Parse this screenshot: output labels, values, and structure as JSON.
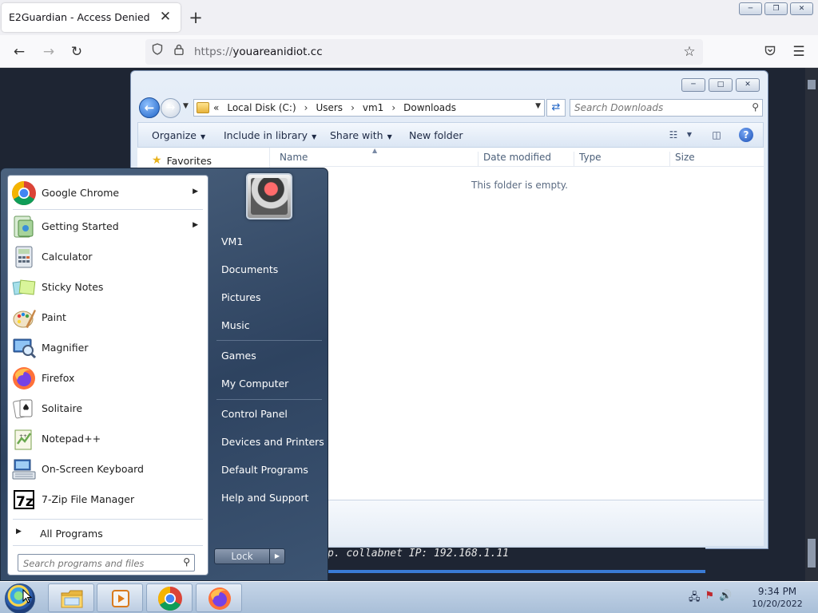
{
  "browser": {
    "tab_title": "E2Guardian - Access Denied",
    "tab_close": "✕",
    "new_tab": "+",
    "url_protocol": "https://",
    "url_host": "youareanidiot.cc"
  },
  "explorer": {
    "crumb_prefix": "«",
    "path": [
      "Local Disk (C:)",
      "Users",
      "vm1",
      "Downloads"
    ],
    "search_placeholder": "Search Downloads",
    "toolbar": {
      "organize": "Organize",
      "include": "Include in library",
      "share": "Share with",
      "new_folder": "New folder"
    },
    "favorites": "Favorites",
    "columns": [
      "Name",
      "Date modified",
      "Type",
      "Size"
    ],
    "empty_message": "This folder is empty."
  },
  "console_text": "p. collabnet   IP: 192.168.1.11",
  "start_menu": {
    "programs": [
      {
        "label": "Google Chrome",
        "submenu": true
      },
      {
        "label": "Getting Started",
        "submenu": true
      },
      {
        "label": "Calculator",
        "submenu": false
      },
      {
        "label": "Sticky Notes",
        "submenu": false
      },
      {
        "label": "Paint",
        "submenu": false
      },
      {
        "label": "Magnifier",
        "submenu": false
      },
      {
        "label": "Firefox",
        "submenu": false
      },
      {
        "label": "Solitaire",
        "submenu": false
      },
      {
        "label": "Notepad++",
        "submenu": false
      },
      {
        "label": "On-Screen Keyboard",
        "submenu": false
      },
      {
        "label": "7-Zip File Manager",
        "submenu": false
      }
    ],
    "all_programs": "All Programs",
    "search_placeholder": "Search programs and files",
    "user_name": "VM1",
    "right_items": {
      "documents": "Documents",
      "pictures": "Pictures",
      "music": "Music",
      "games": "Games",
      "computer": "My Computer",
      "control_panel": "Control Panel",
      "devices": "Devices and Printers",
      "defaults": "Default Programs",
      "help": "Help and Support"
    },
    "lock": "Lock"
  },
  "taskbar": {
    "time": "9:34 PM",
    "date": "10/20/2022"
  },
  "colors": {
    "accent": "#1e63c6",
    "start_menu": "#2e4360",
    "taskbar": "#b9cbe0"
  }
}
